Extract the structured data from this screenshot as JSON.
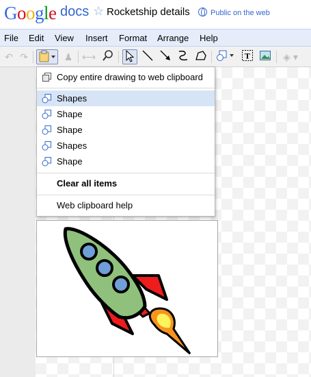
{
  "header": {
    "logo_letters": [
      "G",
      "o",
      "o",
      "g",
      "l",
      "e"
    ],
    "logo_colors": [
      "#3369e8",
      "#d50f25",
      "#eeb211",
      "#3369e8",
      "#009925",
      "#d50f25"
    ],
    "product": "docs",
    "doc_title": "Rocketship details",
    "visibility": "Public on the web"
  },
  "menu": [
    "File",
    "Edit",
    "View",
    "Insert",
    "Format",
    "Arrange",
    "Help"
  ],
  "toolbar": {
    "icons": [
      "undo-icon",
      "redo-icon",
      "web-clipboard-icon",
      "paint-format-icon",
      "fit-icon",
      "zoom-icon",
      "select-icon",
      "line-icon",
      "arrow-icon",
      "curve-icon",
      "polyline-icon",
      "shape-icon",
      "textbox-icon",
      "image-icon",
      "fill-color-icon"
    ]
  },
  "clipboard_menu": {
    "copy_label": "Copy entire drawing to web clipboard",
    "items": [
      {
        "label": "Shapes",
        "highlighted": true
      },
      {
        "label": "Shape",
        "highlighted": false
      },
      {
        "label": "Shape",
        "highlighted": false
      },
      {
        "label": "Shapes",
        "highlighted": false
      },
      {
        "label": "Shape",
        "highlighted": false
      }
    ],
    "clear_label": "Clear all items",
    "help_label": "Web clipboard help"
  },
  "colors": {
    "menubar_bg": "#e6ecf9",
    "highlight": "#d6e4f6",
    "link": "#3366cc",
    "rocket_body": "#8fc17c",
    "rocket_window": "#6f9fd8",
    "rocket_fin": "#ee1c1c",
    "flame_outer": "#f7941d",
    "flame_inner": "#fff35c"
  }
}
